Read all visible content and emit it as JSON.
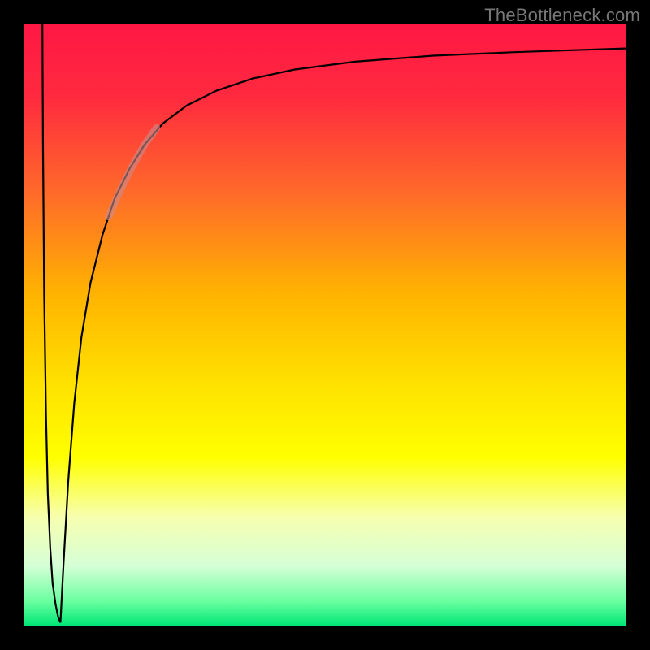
{
  "watermark": "TheBottleneck.com",
  "chart_data": {
    "type": "line",
    "title": "",
    "xlabel": "",
    "ylabel": "",
    "xlim": [
      0,
      100
    ],
    "ylim": [
      0,
      100
    ],
    "legend": false,
    "grid": false,
    "background_gradient": {
      "stops": [
        {
          "offset": 0.0,
          "color": "#ff1744"
        },
        {
          "offset": 0.12,
          "color": "#ff2a3f"
        },
        {
          "offset": 0.28,
          "color": "#ff6a2a"
        },
        {
          "offset": 0.45,
          "color": "#ffb400"
        },
        {
          "offset": 0.6,
          "color": "#ffe200"
        },
        {
          "offset": 0.72,
          "color": "#ffff00"
        },
        {
          "offset": 0.82,
          "color": "#f7ffb0"
        },
        {
          "offset": 0.9,
          "color": "#d6ffd6"
        },
        {
          "offset": 0.96,
          "color": "#6affa0"
        },
        {
          "offset": 1.0,
          "color": "#00e676"
        }
      ]
    },
    "series": [
      {
        "name": "curve-left",
        "stroke": "#000000",
        "stroke_width": 2.2,
        "x": [
          3.0,
          3.1,
          3.3,
          3.6,
          3.9,
          4.3,
          4.7,
          5.2,
          5.6,
          6.0
        ],
        "y": [
          100.0,
          80.0,
          55.0,
          35.0,
          22.0,
          13.0,
          7.0,
          3.5,
          1.5,
          0.5
        ]
      },
      {
        "name": "curve-main",
        "stroke": "#000000",
        "stroke_width": 2.2,
        "x": [
          6.0,
          6.5,
          7.3,
          8.3,
          9.5,
          11.0,
          13.0,
          15.0,
          17.5,
          20.0,
          23.0,
          27.0,
          32.0,
          38.0,
          45.0,
          55.0,
          68.0,
          82.0,
          100.0
        ],
        "y": [
          0.5,
          10.0,
          24.0,
          37.0,
          48.0,
          57.0,
          65.0,
          71.0,
          76.0,
          80.0,
          83.5,
          86.5,
          89.0,
          91.0,
          92.5,
          93.8,
          94.8,
          95.4,
          96.0
        ]
      },
      {
        "name": "highlight-band",
        "stroke": "#c98a8a",
        "stroke_width": 9,
        "opacity": 0.62,
        "linecap": "round",
        "x": [
          14.0,
          16.0,
          18.0,
          20.0,
          22.0
        ],
        "y": [
          68.0,
          72.5,
          76.5,
          80.0,
          82.8
        ]
      }
    ]
  }
}
